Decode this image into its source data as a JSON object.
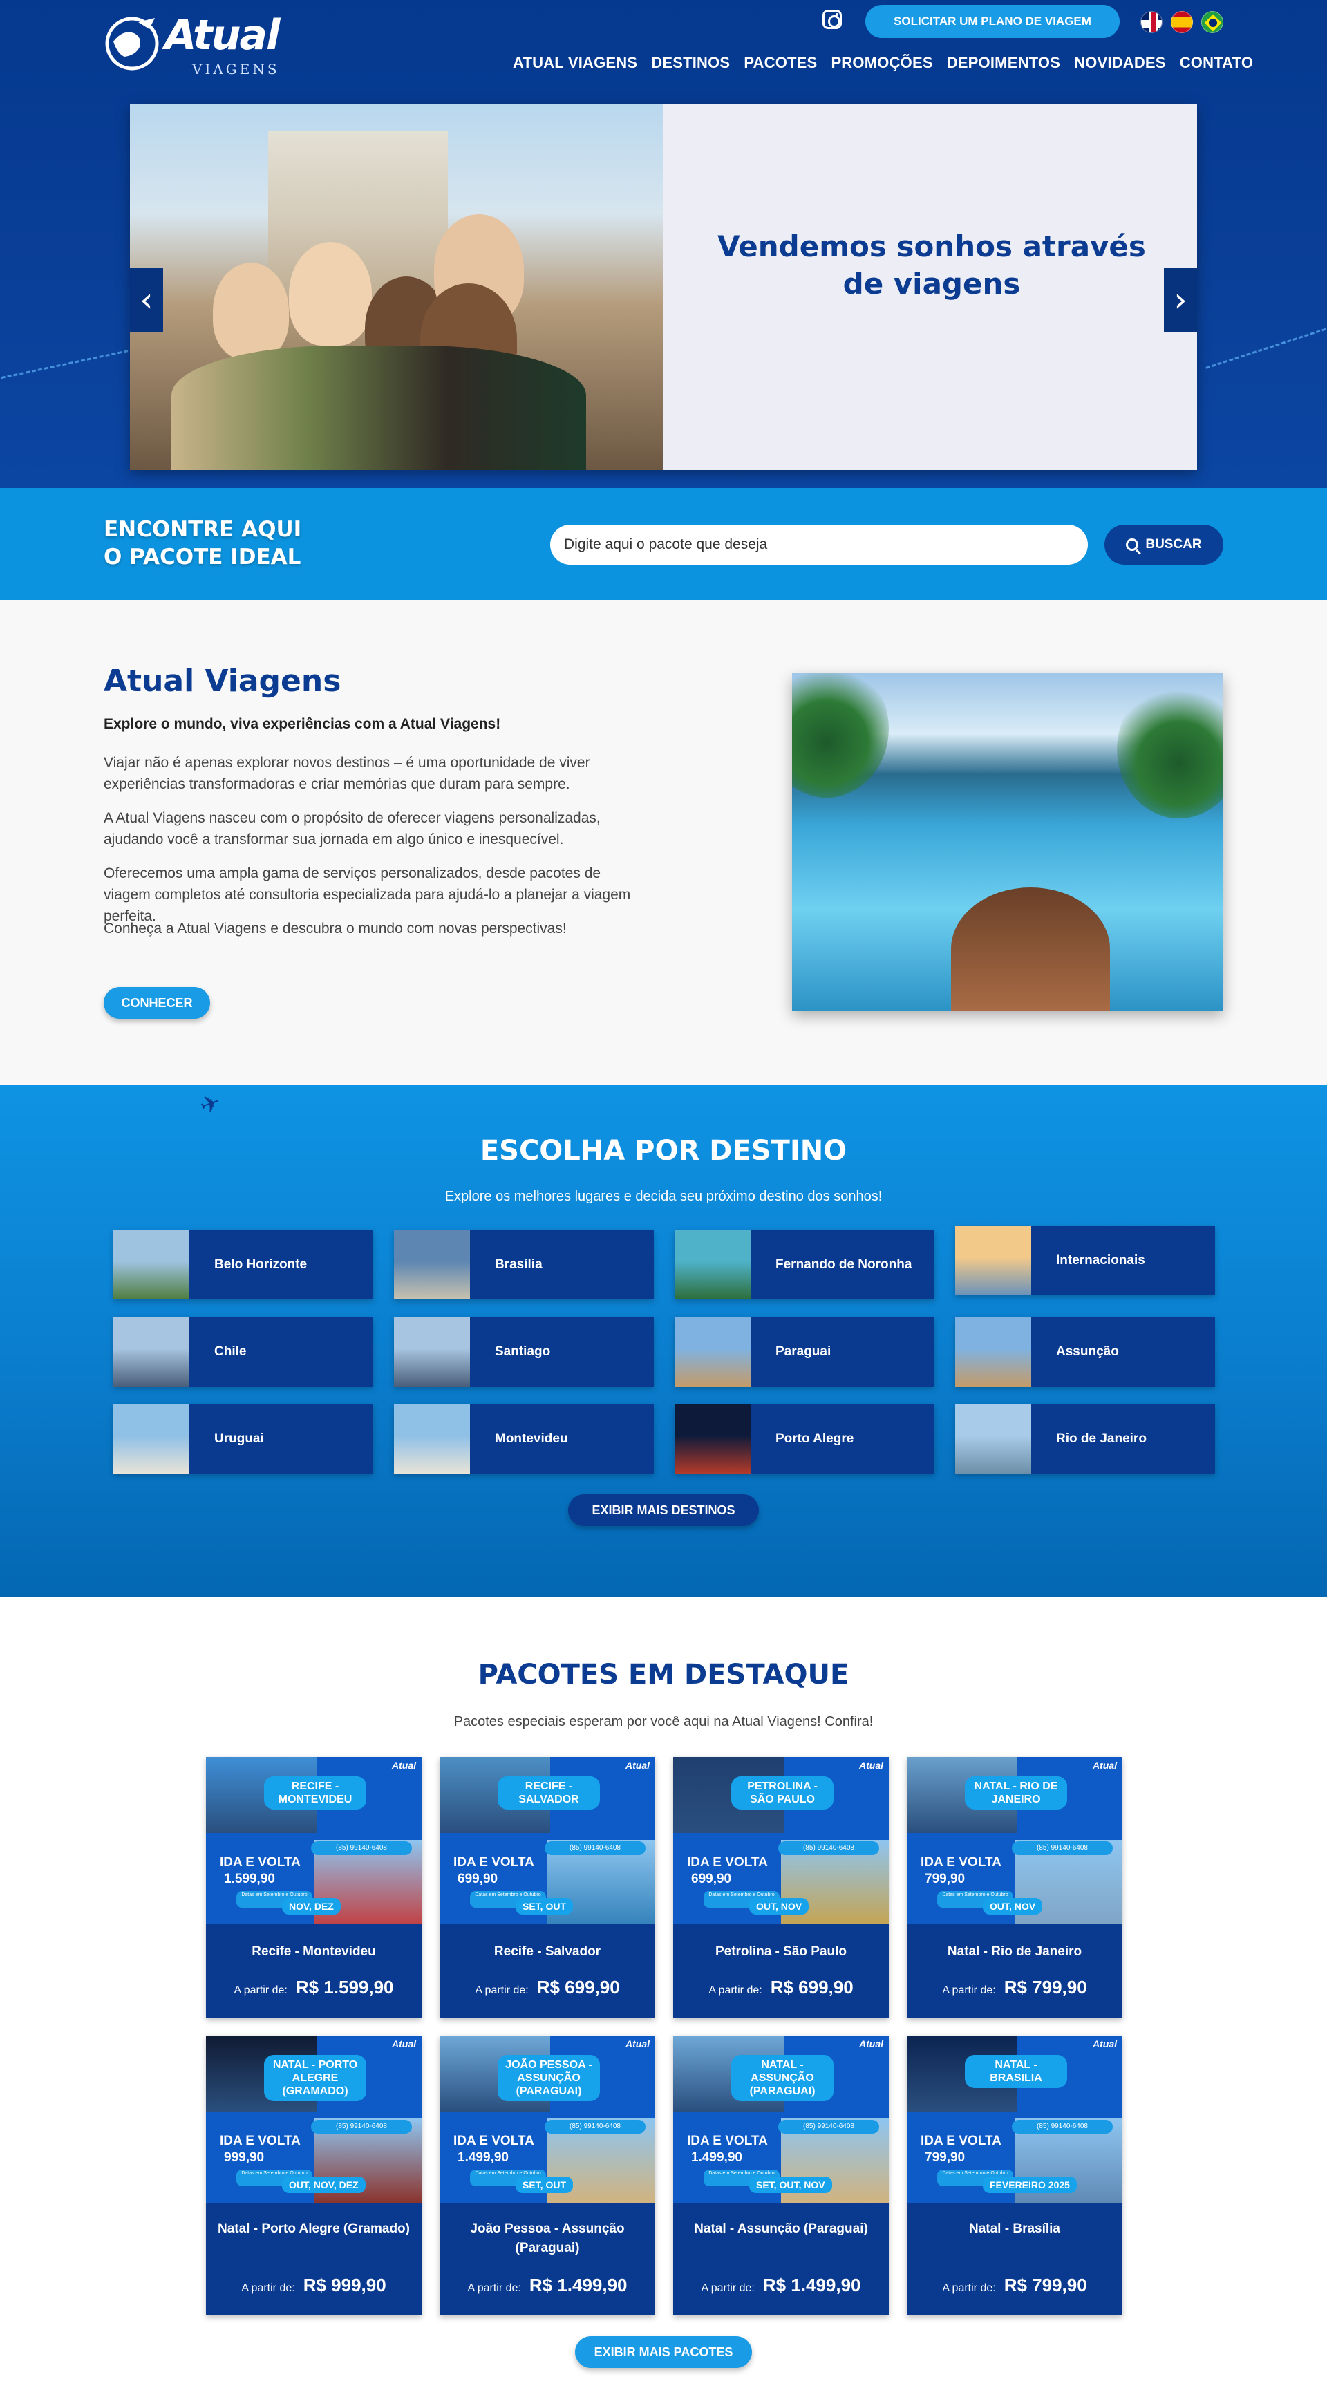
{
  "colors": {
    "primary": "#0a3f98",
    "accent": "#1a9be6",
    "band": "#0c93df",
    "title": "#0b3c91"
  },
  "header": {
    "logo_main": "Atual",
    "logo_sub": "VIAGENS",
    "instagram_icon": "instagram-icon",
    "plan_button": "SOLICITAR UM PLANO DE VIAGEM",
    "languages": [
      "English",
      "Español",
      "Português"
    ],
    "nav": [
      "ATUAL VIAGENS",
      "DESTINOS",
      "PACOTES",
      "PROMOÇÕES",
      "DEPOIMENTOS",
      "NOVIDADES",
      "CONTATO"
    ]
  },
  "hero": {
    "title": "Vendemos sonhos através de viagens",
    "prev_icon": "chevron-left-icon",
    "next_icon": "chevron-right-icon",
    "prev_glyph": "‹",
    "next_glyph": "›"
  },
  "search": {
    "title_line1": "ENCONTRE AQUI",
    "title_line2": "O PACOTE IDEAL",
    "placeholder": "Digite aqui o pacote que deseja",
    "button": "BUSCAR"
  },
  "about": {
    "title": "Atual Viagens",
    "lead": "Explore o mundo, viva experiências com a Atual Viagens!",
    "paragraphs": [
      "Viajar não é apenas explorar novos destinos – é uma oportunidade de viver experiências transformadoras e criar memórias que duram para sempre.",
      "A Atual Viagens nasceu com o propósito de oferecer viagens personalizadas, ajudando você a transformar sua jornada em algo único e inesquecível.",
      "Oferecemos uma ampla gama de serviços personalizados, desde pacotes de viagem completos até consultoria especializada para ajudá-lo a planejar a viagem perfeita.",
      "Conheça a Atual Viagens e descubra o mundo com novas perspectivas!"
    ],
    "button": "CONHECER"
  },
  "destinations": {
    "title": "ESCOLHA POR DESTINO",
    "subtitle": "Explore os melhores lugares e decida seu próximo destino dos sonhos!",
    "items": [
      {
        "name": "Belo Horizonte",
        "c1": "#9ec3e0",
        "c2": "#4f7d3f"
      },
      {
        "name": "Brasília",
        "c1": "#5d86b2",
        "c2": "#c9c2b0"
      },
      {
        "name": "Fernando de Noronha",
        "c1": "#4fb2c9",
        "c2": "#2d6e3a"
      },
      {
        "name": "Internacionais",
        "c1": "#f3c98a",
        "c2": "#6b93b9"
      },
      {
        "name": "Chile",
        "c1": "#a7c4e0",
        "c2": "#4b5f7a"
      },
      {
        "name": "Santiago",
        "c1": "#a7c4e0",
        "c2": "#4b5f7a"
      },
      {
        "name": "Paraguai",
        "c1": "#7fb2e0",
        "c2": "#c49b6a"
      },
      {
        "name": "Assunção",
        "c1": "#7fb2e0",
        "c2": "#c49b6a"
      },
      {
        "name": "Uruguai",
        "c1": "#8fc0e6",
        "c2": "#e8e3d8"
      },
      {
        "name": "Montevideu",
        "c1": "#8fc0e6",
        "c2": "#e8e3d8"
      },
      {
        "name": "Porto Alegre",
        "c1": "#0d1a3a",
        "c2": "#b43a2a"
      },
      {
        "name": "Rio de Janeiro",
        "c1": "#a8cbe9",
        "c2": "#6d8fa8"
      }
    ],
    "button": "EXIBIR MAIS DESTINOS"
  },
  "packages": {
    "title": "PACOTES EM DESTAQUE",
    "subtitle": "Pacotes especiais esperam por você aqui na Atual Viagens! Confira!",
    "price_label": "A partir de:",
    "ida_volta": "IDA E VOLTA",
    "whatsapp": "(85) 99140-6408",
    "mini_logo": "Atual",
    "note": "Datas em Setembro e Outubro",
    "items": [
      {
        "badge": "RECIFE - MONTEVIDEU",
        "img_price": "1.599,90",
        "months": "NOV, DEZ",
        "title": "Recife - Montevideu",
        "price": "R$ 1.599,90"
      },
      {
        "badge": "RECIFE - SALVADOR",
        "img_price": "699,90",
        "months": "SET, OUT",
        "title": "Recife - Salvador",
        "price": "R$ 699,90"
      },
      {
        "badge": "PETROLINA - SÃO PAULO",
        "img_price": "699,90",
        "months": "OUT, NOV",
        "title": "Petrolina - São Paulo",
        "price": "R$ 699,90"
      },
      {
        "badge": "NATAL - RIO DE JANEIRO",
        "img_price": "799,90",
        "months": "OUT, NOV",
        "title": "Natal - Rio de Janeiro",
        "price": "R$ 799,90"
      },
      {
        "badge": "NATAL - PORTO ALEGRE (GRAMADO)",
        "img_price": "999,90",
        "months": "OUT, NOV, DEZ",
        "title": "Natal - Porto Alegre (Gramado)",
        "price": "R$ 999,90"
      },
      {
        "badge": "JOÃO PESSOA - ASSUNÇÃO (PARAGUAI)",
        "img_price": "1.499,90",
        "months": "SET, OUT",
        "title": "João Pessoa - Assunção (Paraguai)",
        "price": "R$ 1.499,90"
      },
      {
        "badge": "NATAL - ASSUNÇÃO (PARAGUAI)",
        "img_price": "1.499,90",
        "months": "SET, OUT, NOV",
        "title": "Natal - Assunção (Paraguai)",
        "price": "R$ 1.499,90"
      },
      {
        "badge": "NATAL - BRASILIA",
        "img_price": "799,90",
        "months": "FEVEREIRO 2025",
        "title": "Natal - Brasília",
        "price": "R$ 799,90"
      }
    ],
    "button": "EXIBIR MAIS PACOTES"
  }
}
